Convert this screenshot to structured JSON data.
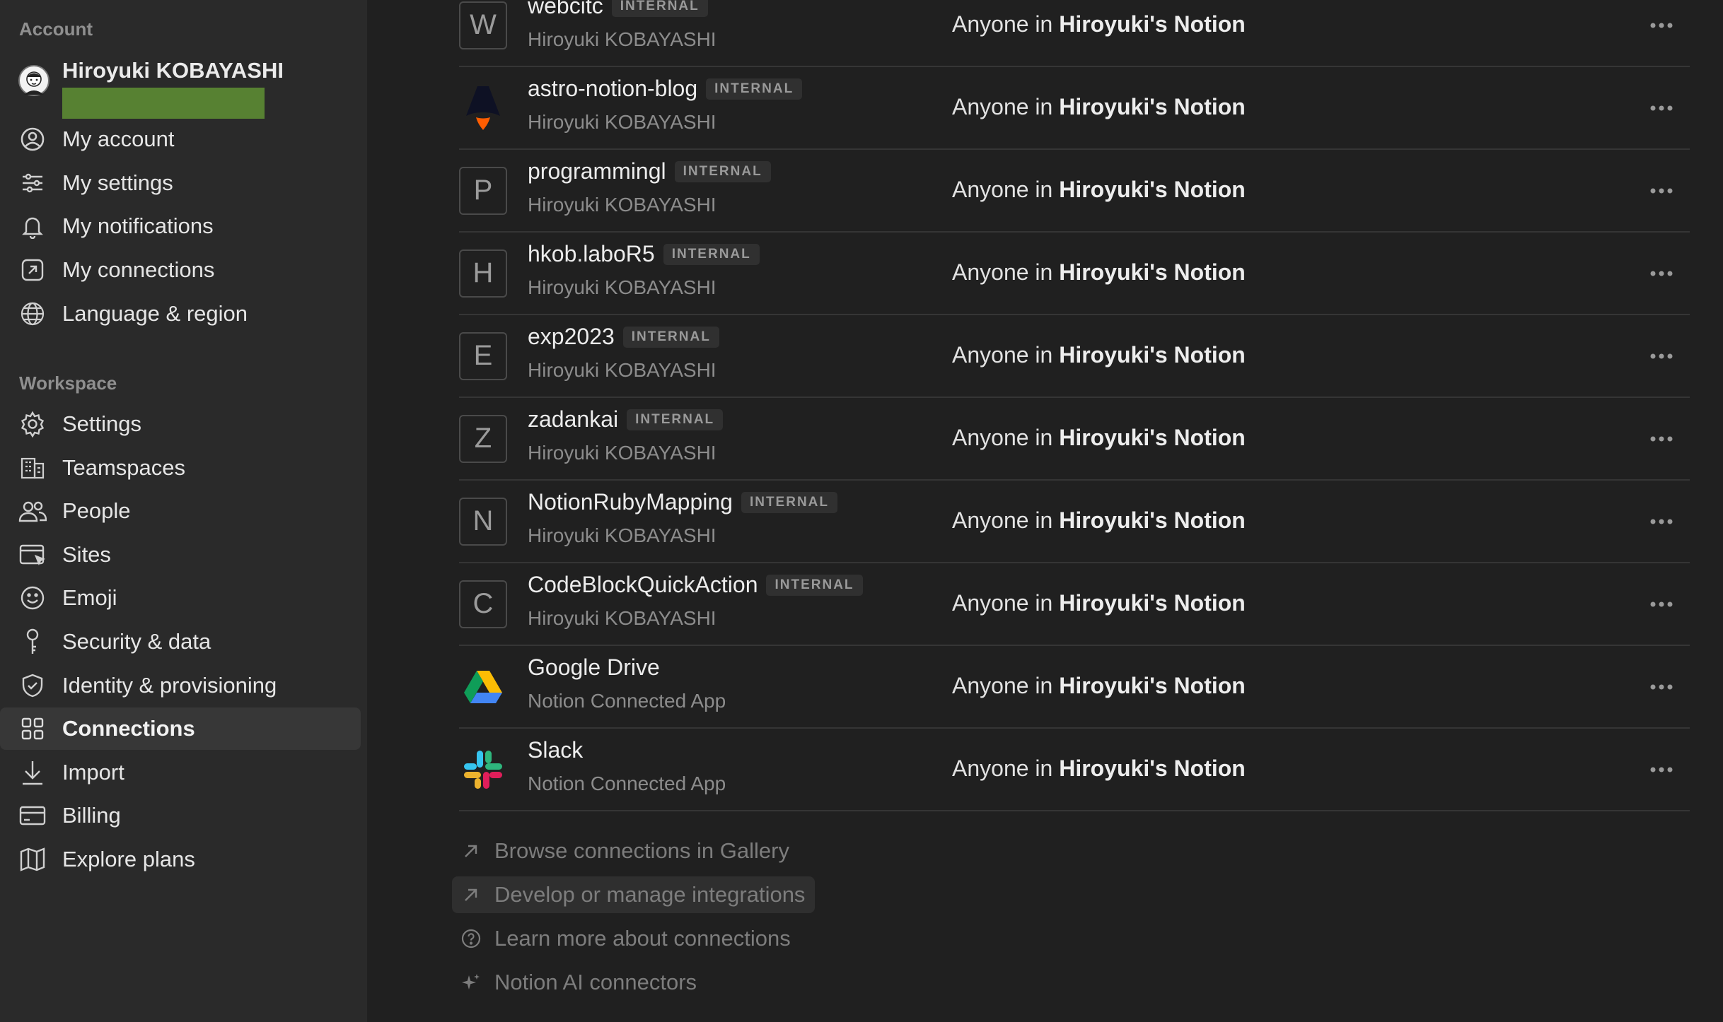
{
  "sidebar": {
    "account_heading": "Account",
    "user": {
      "name": "Hiroyuki KOBAYASHI"
    },
    "account_items": [
      {
        "label": "My account",
        "icon": "user-circle-icon"
      },
      {
        "label": "My settings",
        "icon": "sliders-icon"
      },
      {
        "label": "My notifications",
        "icon": "bell-icon"
      },
      {
        "label": "My connections",
        "icon": "arrow-box-icon"
      },
      {
        "label": "Language & region",
        "icon": "globe-icon"
      }
    ],
    "workspace_heading": "Workspace",
    "workspace_items": [
      {
        "label": "Settings",
        "icon": "gear-icon"
      },
      {
        "label": "Teamspaces",
        "icon": "building-icon"
      },
      {
        "label": "People",
        "icon": "people-icon"
      },
      {
        "label": "Sites",
        "icon": "browser-icon"
      },
      {
        "label": "Emoji",
        "icon": "smiley-icon"
      },
      {
        "label": "Security & data",
        "icon": "key-icon"
      },
      {
        "label": "Identity & provisioning",
        "icon": "shield-icon"
      },
      {
        "label": "Connections",
        "icon": "grid-icon",
        "active": true
      },
      {
        "label": "Import",
        "icon": "download-icon"
      },
      {
        "label": "Billing",
        "icon": "credit-card-icon"
      },
      {
        "label": "Explore plans",
        "icon": "map-icon"
      }
    ]
  },
  "connections": {
    "access_prefix": "Anyone in",
    "access_workspace": "Hiroyuki's Notion",
    "rows": [
      {
        "letter": "W",
        "name": "webcitc",
        "badge": "INTERNAL",
        "owner": "Hiroyuki KOBAYASHI"
      },
      {
        "letter": "",
        "logo": "astro-logo-icon",
        "name": "astro-notion-blog",
        "badge": "INTERNAL",
        "owner": "Hiroyuki KOBAYASHI"
      },
      {
        "letter": "P",
        "name": "programmingl",
        "badge": "INTERNAL",
        "owner": "Hiroyuki KOBAYASHI"
      },
      {
        "letter": "H",
        "name": "hkob.laboR5",
        "badge": "INTERNAL",
        "owner": "Hiroyuki KOBAYASHI"
      },
      {
        "letter": "E",
        "name": "exp2023",
        "badge": "INTERNAL",
        "owner": "Hiroyuki KOBAYASHI"
      },
      {
        "letter": "Z",
        "name": "zadankai",
        "badge": "INTERNAL",
        "owner": "Hiroyuki KOBAYASHI"
      },
      {
        "letter": "N",
        "name": "NotionRubyMapping",
        "badge": "INTERNAL",
        "owner": "Hiroyuki KOBAYASHI"
      },
      {
        "letter": "C",
        "name": "CodeBlockQuickAction",
        "badge": "INTERNAL",
        "owner": "Hiroyuki KOBAYASHI"
      },
      {
        "letter": "",
        "logo": "google-drive-logo-icon",
        "name": "Google Drive",
        "badge": "",
        "owner": "Notion Connected App"
      },
      {
        "letter": "",
        "logo": "slack-logo-icon",
        "name": "Slack",
        "badge": "",
        "owner": "Notion Connected App"
      }
    ]
  },
  "footer_links": [
    {
      "label": "Browse connections in Gallery",
      "icon": "arrow-up-right-icon"
    },
    {
      "label": "Develop or manage integrations",
      "icon": "arrow-up-right-icon"
    },
    {
      "label": "Learn more about connections",
      "icon": "question-circle-icon"
    },
    {
      "label": "Notion AI connectors",
      "icon": "sparkle-icon"
    }
  ],
  "colors": {
    "background": "#202020",
    "sidebar": "#2a2a2a",
    "active_item": "#373737",
    "redaction": "#578132"
  }
}
